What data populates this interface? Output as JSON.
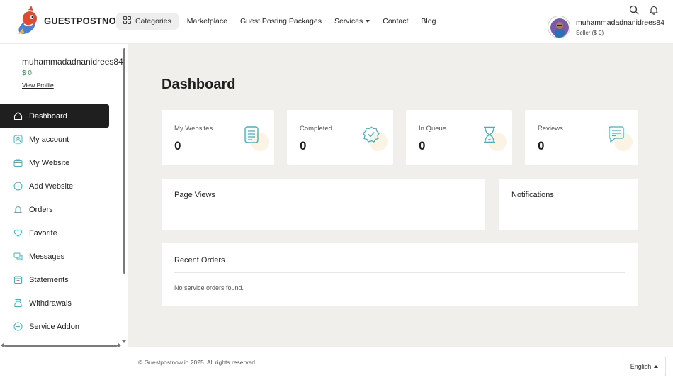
{
  "header": {
    "brand": "GUESTPOSTNOW",
    "nav": {
      "categories": "Categories",
      "marketplace": "Marketplace",
      "packages": "Guest Posting Packages",
      "services": "Services",
      "contact": "Contact",
      "blog": "Blog"
    },
    "user": {
      "name": "muhammadadnanidrees84",
      "role": "Seller ($ 0)"
    }
  },
  "sidebar": {
    "user_name": "muhammadadnanidrees84",
    "balance": "$ 0",
    "view_profile": "View Profile",
    "items": [
      {
        "label": "Dashboard",
        "icon": "home-icon"
      },
      {
        "label": "My account",
        "icon": "user-icon"
      },
      {
        "label": "My Website",
        "icon": "briefcase-icon"
      },
      {
        "label": "Add Website",
        "icon": "plus-circle-icon"
      },
      {
        "label": "Orders",
        "icon": "bell-icon"
      },
      {
        "label": "Favorite",
        "icon": "heart-icon"
      },
      {
        "label": "Messages",
        "icon": "chat-icon"
      },
      {
        "label": "Statements",
        "icon": "calendar-icon"
      },
      {
        "label": "Withdrawals",
        "icon": "money-bag-icon"
      },
      {
        "label": "Service Addon",
        "icon": "plus-circle-icon"
      }
    ]
  },
  "main": {
    "title": "Dashboard",
    "stats": [
      {
        "label": "My Websites",
        "value": "0",
        "icon": "document-icon"
      },
      {
        "label": "Completed",
        "value": "0",
        "icon": "badge-check-icon"
      },
      {
        "label": "In Queue",
        "value": "0",
        "icon": "hourglass-icon"
      },
      {
        "label": "Reviews",
        "value": "0",
        "icon": "comment-icon"
      }
    ],
    "page_views": "Page Views",
    "notifications": "Notifications",
    "recent_orders": {
      "title": "Recent Orders",
      "empty": "No service orders found."
    }
  },
  "footer": {
    "copyright": "© Guestpostnow.io 2025. All rights reserved.",
    "language": "English"
  },
  "colors": {
    "accent_teal": "#3fb3c6",
    "balance_green": "#2a9d5c",
    "active_bg": "#1f1f1f",
    "content_bg": "#f0efec"
  }
}
